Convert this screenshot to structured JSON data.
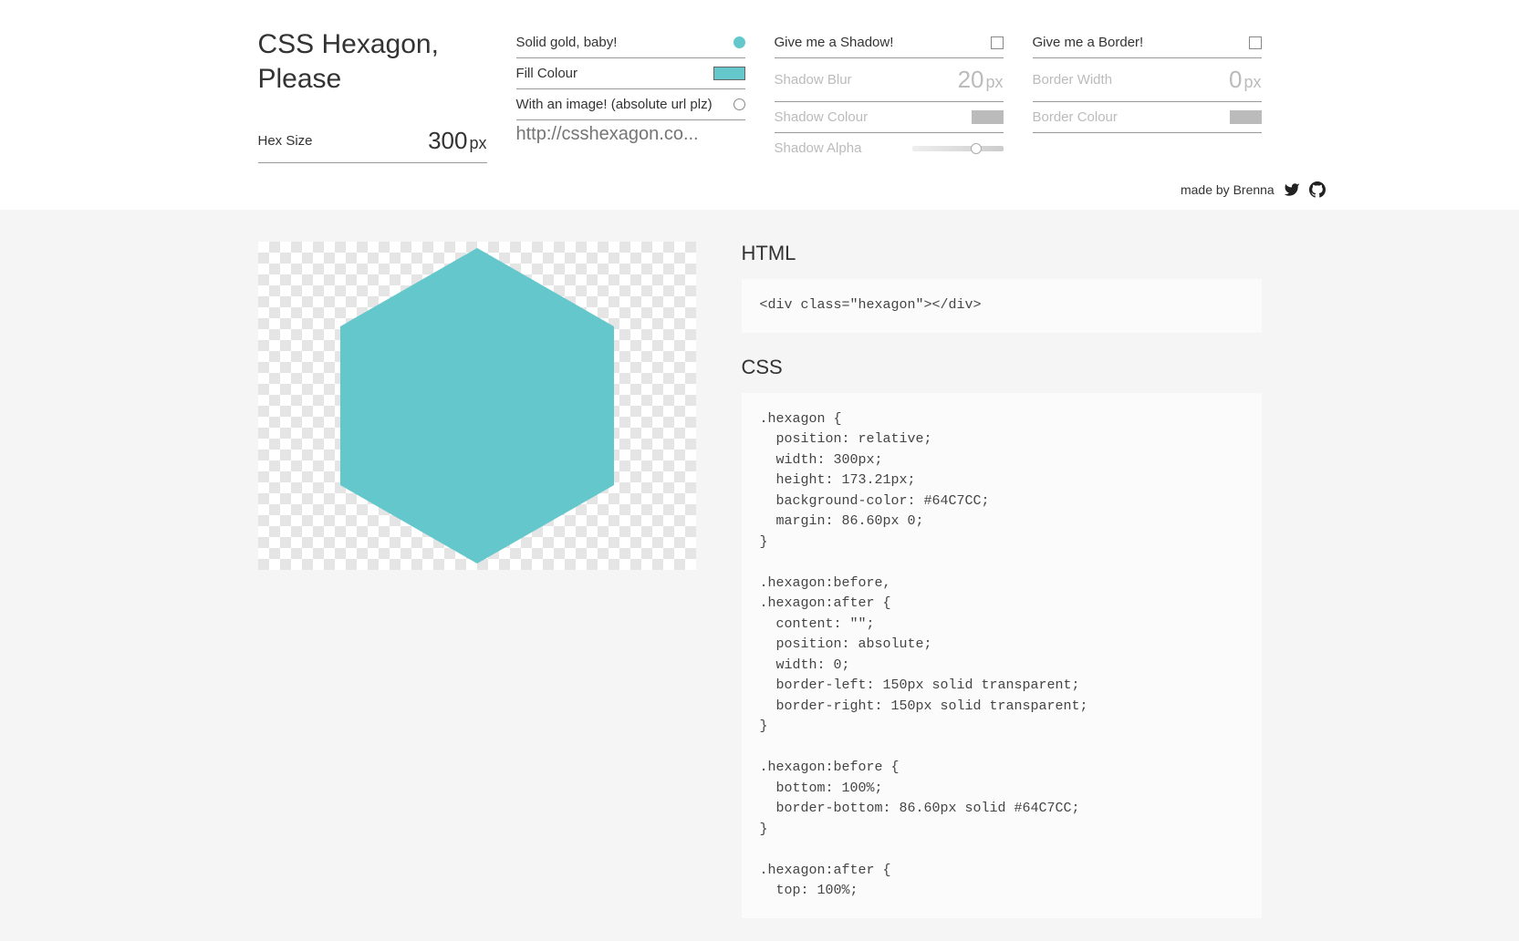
{
  "title": "CSS Hexagon, Please",
  "hexSize": {
    "label": "Hex Size",
    "value": "300",
    "unit": "px"
  },
  "fill": {
    "solidLabel": "Solid gold, baby!",
    "colourLabel": "Fill Colour",
    "imageLabel": "With an image! (absolute url plz)",
    "urlPlaceholder": "http://csshexagon.co..."
  },
  "shadow": {
    "title": "Give me a Shadow!",
    "blurLabel": "Shadow Blur",
    "blurValue": "20",
    "blurUnit": "px",
    "colourLabel": "Shadow Colour",
    "alphaLabel": "Shadow Alpha"
  },
  "border": {
    "title": "Give me a Border!",
    "widthLabel": "Border Width",
    "widthValue": "0",
    "widthUnit": "px",
    "colourLabel": "Border Colour"
  },
  "credit": {
    "text": "made by Brenna"
  },
  "output": {
    "htmlHeading": "HTML",
    "cssHeading": "CSS",
    "htmlCode": "<div class=\"hexagon\"></div>",
    "cssCode": ".hexagon {\n  position: relative;\n  width: 300px; \n  height: 173.21px;\n  background-color: #64C7CC;\n  margin: 86.60px 0;\n}\n\n.hexagon:before,\n.hexagon:after {\n  content: \"\";\n  position: absolute;\n  width: 0;\n  border-left: 150px solid transparent;\n  border-right: 150px solid transparent;\n}\n\n.hexagon:before {\n  bottom: 100%;\n  border-bottom: 86.60px solid #64C7CC;\n}\n\n.hexagon:after {\n  top: 100%;"
  },
  "colors": {
    "accent": "#64C7CC"
  }
}
